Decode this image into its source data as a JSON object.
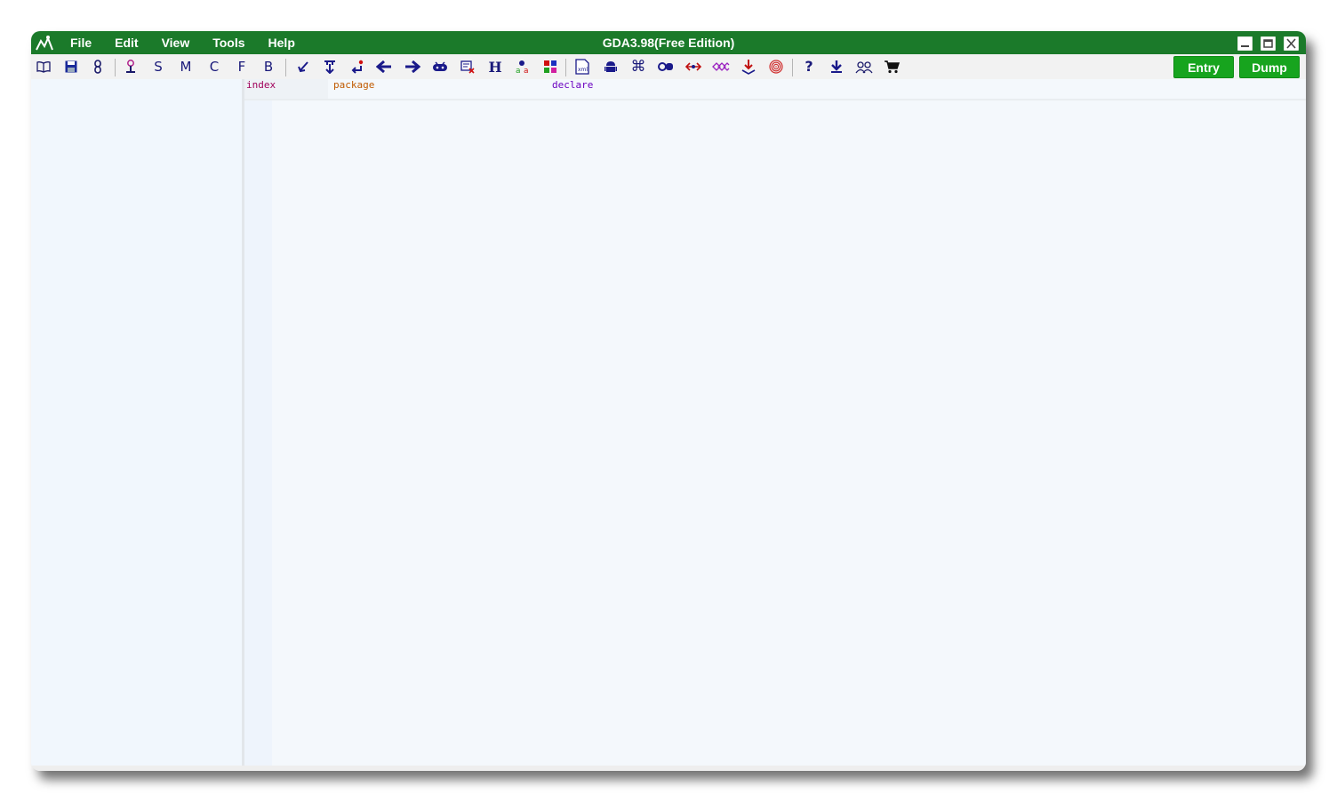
{
  "window": {
    "title": "GDA3.98(Free Edition)",
    "accent_color": "#1b7a2a"
  },
  "menu": [
    "File",
    "Edit",
    "View",
    "Tools",
    "Help"
  ],
  "window_controls": [
    "minimize-icon",
    "maximize-icon",
    "close-icon"
  ],
  "toolbar": {
    "letters": {
      "s": "S",
      "m": "M",
      "c": "C",
      "f": "F",
      "b": "B",
      "h": "H"
    },
    "icons": [
      "open-book-icon",
      "save-icon",
      "link-icon",
      "tree-icon",
      "checkmark-arrow-icon",
      "jump-down-icon",
      "return-icon",
      "back-arrow-icon",
      "forward-arrow-icon",
      "android-robot-icon",
      "search-doc-icon",
      "string-icon",
      "color-grid-icon",
      "xml-icon",
      "android-icon",
      "command-icon",
      "toggle-icon",
      "swap-icon",
      "chain-icon",
      "download-red-icon",
      "fingerprint-icon",
      "help-icon",
      "download-icon",
      "users-icon",
      "cart-icon"
    ],
    "entry_label": "Entry",
    "dump_label": "Dump"
  },
  "tabs": [
    {
      "label": "index",
      "color": "#a0005a"
    },
    {
      "label": "package",
      "color": "#c05a00"
    },
    {
      "label": "declare",
      "color": "#6a00c0"
    }
  ]
}
